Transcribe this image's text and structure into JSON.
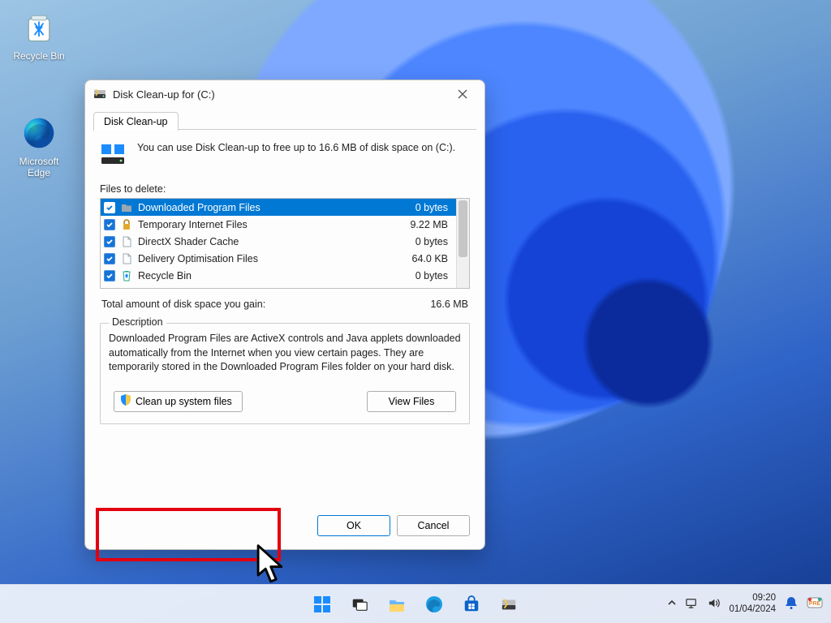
{
  "desktop_icons": {
    "recycle_bin": "Recycle Bin",
    "edge": "Microsoft Edge"
  },
  "window": {
    "title": "Disk Clean-up for  (C:)",
    "tab_label": "Disk Clean-up",
    "intro_text": "You can use Disk Clean-up to free up to 16.6 MB of disk space on (C:).",
    "files_to_delete_label": "Files to delete:",
    "list": [
      {
        "name": "Downloaded Program Files",
        "size": "0 bytes",
        "checked": true,
        "selected": true,
        "icon": "folder"
      },
      {
        "name": "Temporary Internet Files",
        "size": "9.22 MB",
        "checked": true,
        "selected": false,
        "icon": "lock"
      },
      {
        "name": "DirectX Shader Cache",
        "size": "0 bytes",
        "checked": true,
        "selected": false,
        "icon": "file"
      },
      {
        "name": "Delivery Optimisation Files",
        "size": "64.0 KB",
        "checked": true,
        "selected": false,
        "icon": "file"
      },
      {
        "name": "Recycle Bin",
        "size": "0 bytes",
        "checked": true,
        "selected": false,
        "icon": "recycle"
      }
    ],
    "total_label": "Total amount of disk space you gain:",
    "total_value": "16.6 MB",
    "description_legend": "Description",
    "description_text": "Downloaded Program Files are ActiveX controls and Java applets downloaded automatically from the Internet when you view certain pages. They are temporarily stored in the Downloaded Program Files folder on your hard disk.",
    "cleanup_system_label": "Clean up system files",
    "view_files_label": "View Files",
    "ok_label": "OK",
    "cancel_label": "Cancel"
  },
  "taskbar": {
    "time": "09:20",
    "date": "01/04/2024"
  }
}
